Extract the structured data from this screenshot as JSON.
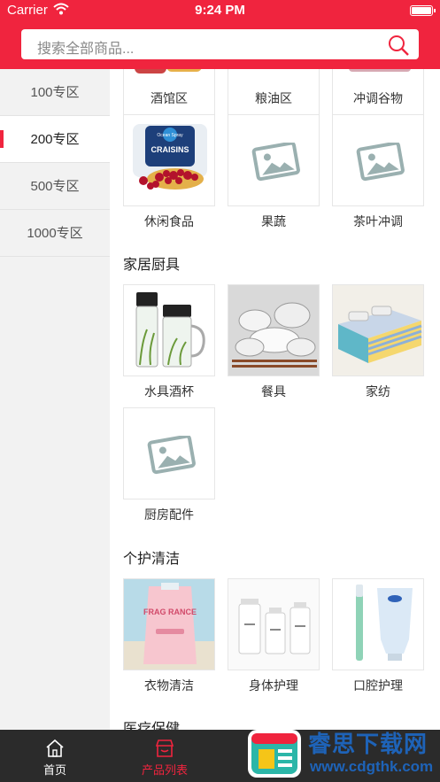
{
  "status_bar": {
    "carrier": "Carrier",
    "time": "9:24 PM"
  },
  "search": {
    "placeholder": "搜索全部商品..."
  },
  "sidebar": {
    "items": [
      {
        "label": "100专区"
      },
      {
        "label": "200专区",
        "active": true
      },
      {
        "label": "500专区"
      },
      {
        "label": "1000专区"
      }
    ]
  },
  "content": {
    "top_row": [
      {
        "label": "酒馆区"
      },
      {
        "label": "粮油区"
      },
      {
        "label": "冲调谷物"
      }
    ],
    "food_row": [
      {
        "label": "休闲食品",
        "image": "craisins-package"
      },
      {
        "label": "果蔬",
        "image": "placeholder-image-icon"
      },
      {
        "label": "茶叶冲调",
        "image": "placeholder-image-icon"
      }
    ],
    "home_title": "家居厨具",
    "home_items": [
      {
        "label": "水具酒杯",
        "image": "glass-bottles"
      },
      {
        "label": "餐具",
        "image": "tableware"
      },
      {
        "label": "家纺",
        "image": "bedding"
      },
      {
        "label": "厨房配件",
        "image": "placeholder-image-icon"
      }
    ],
    "care_title": "个护清洁",
    "care_items": [
      {
        "label": "衣物清洁",
        "image": "detergent-pouch"
      },
      {
        "label": "身体护理",
        "image": "lotion-bottles"
      },
      {
        "label": "口腔护理",
        "image": "toothbrush-toothpaste"
      }
    ],
    "medical_title": "医疗保健",
    "product_text": {
      "craisins_brand": "Ocean Spray",
      "craisins_name": "CRAISINS",
      "detergent_text": "FRAG RANCE"
    }
  },
  "tabbar": {
    "tabs": [
      {
        "label": "首页",
        "icon": "home-icon"
      },
      {
        "label": "产品列表",
        "icon": "store-icon",
        "active": true
      }
    ]
  },
  "watermark": {
    "title": "睿思下载网",
    "url": "www.cdgthk.com"
  },
  "colors": {
    "brand": "#f0243e",
    "tabbar_bg": "#2b2b2b",
    "watermark": "#1e63b8"
  }
}
